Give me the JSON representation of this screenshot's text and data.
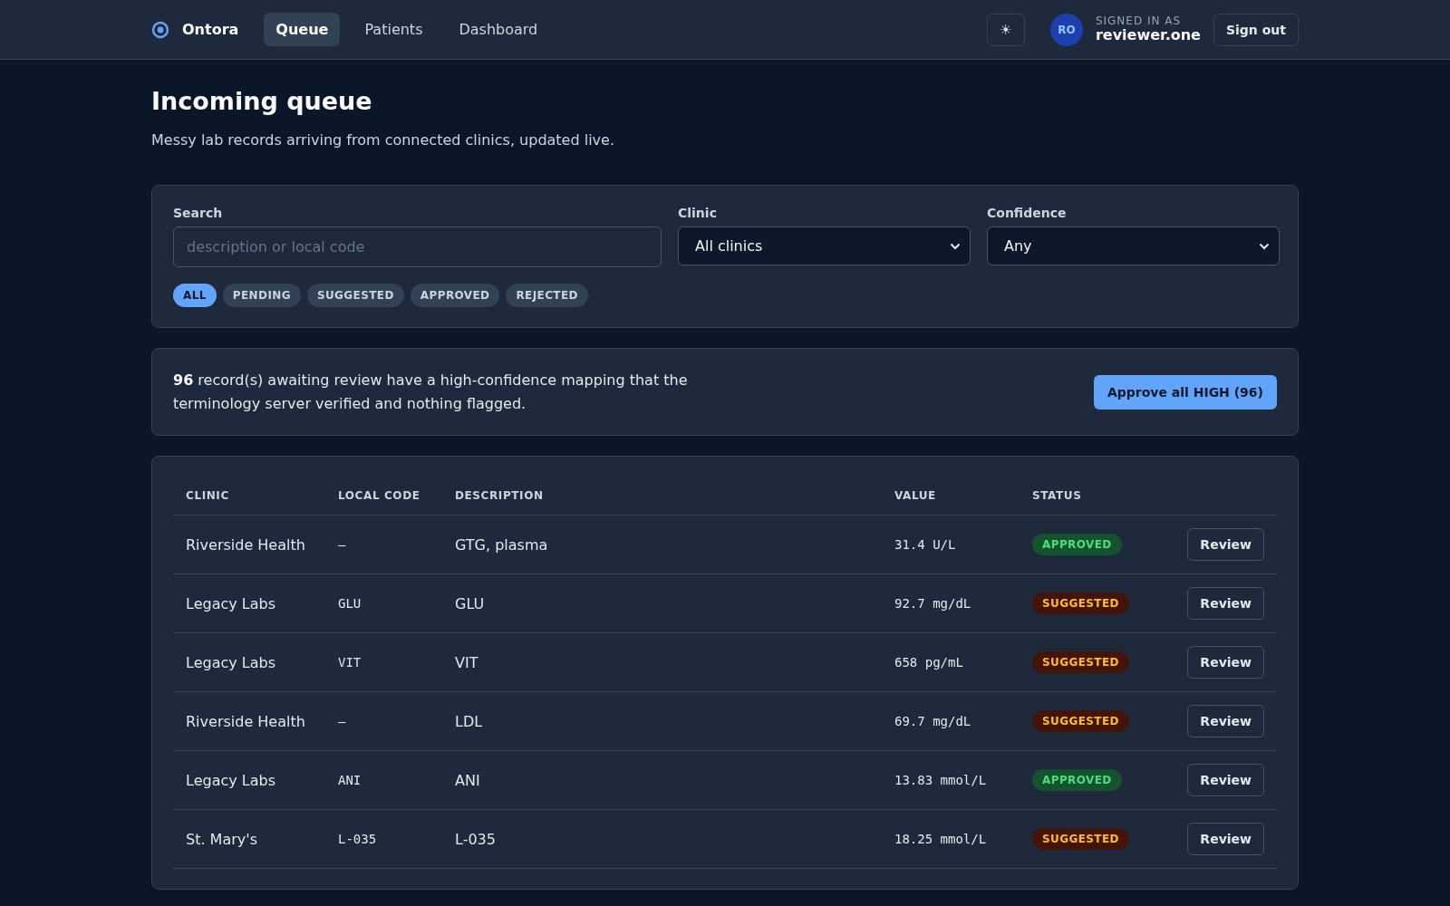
{
  "nav": {
    "brand": "Ontora",
    "links": [
      {
        "label": "Queue",
        "selected": true
      },
      {
        "label": "Patients",
        "selected": false
      },
      {
        "label": "Dashboard",
        "selected": false
      }
    ],
    "theme_toggle": "☀",
    "user": {
      "initials": "RO",
      "caption": "SIGNED IN AS",
      "name": "reviewer.one"
    },
    "sign_out": "Sign out"
  },
  "page": {
    "title": "Incoming queue",
    "subtitle": "Messy lab records arriving from connected clinics, updated live."
  },
  "filters": {
    "search": {
      "label": "Search",
      "placeholder": "description or local code"
    },
    "clinic": {
      "label": "Clinic",
      "value": "All clinics"
    },
    "confidence": {
      "label": "Confidence",
      "value": "Any"
    },
    "chips": [
      {
        "label": "ALL",
        "selected": true
      },
      {
        "label": "PENDING",
        "selected": false
      },
      {
        "label": "SUGGESTED",
        "selected": false
      },
      {
        "label": "APPROVED",
        "selected": false
      },
      {
        "label": "REJECTED",
        "selected": false
      }
    ]
  },
  "banner": {
    "text": "**96** record(s) awaiting review have a high-confidence mapping that the terminology server verified and nothing flagged.",
    "button": "Approve all HIGH (96)"
  },
  "table": {
    "columns": [
      "CLINIC",
      "LOCAL CODE",
      "DESCRIPTION",
      "VALUE",
      "STATUS"
    ],
    "rows": [
      {
        "clinic": "Riverside Health",
        "local_code": "–",
        "description": "GTG, plasma",
        "value": "31.4 U/L",
        "status": "APPROVED",
        "kind": "approved",
        "action": "Review"
      },
      {
        "clinic": "Legacy Labs",
        "local_code": "GLU",
        "description": "GLU",
        "value": "92.7 mg/dL",
        "status": "SUGGESTED",
        "kind": "suggested",
        "action": "Review"
      },
      {
        "clinic": "Legacy Labs",
        "local_code": "VIT",
        "description": "VIT",
        "value": "658 pg/mL",
        "status": "SUGGESTED",
        "kind": "suggested",
        "action": "Review"
      },
      {
        "clinic": "Riverside Health",
        "local_code": "–",
        "description": "LDL",
        "value": "69.7 mg/dL",
        "status": "SUGGESTED",
        "kind": "suggested",
        "action": "Review"
      },
      {
        "clinic": "Legacy Labs",
        "local_code": "ANI",
        "description": "ANI",
        "value": "13.83 mmol/L",
        "status": "APPROVED",
        "kind": "approved",
        "action": "Review"
      },
      {
        "clinic": "St. Mary's",
        "local_code": "L-035",
        "description": "L-035",
        "value": "18.25 mmol/L",
        "status": "SUGGESTED",
        "kind": "suggested",
        "action": "Review"
      }
    ]
  }
}
